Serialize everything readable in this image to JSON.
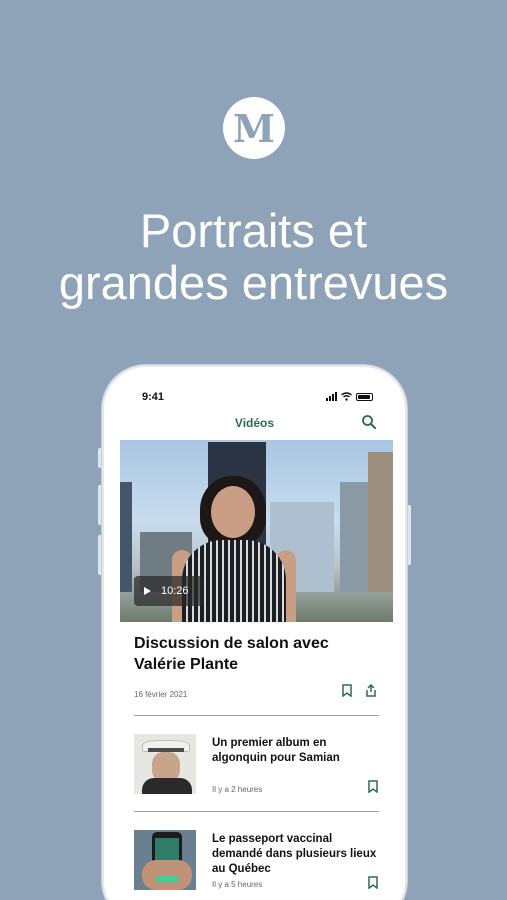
{
  "brand": {
    "logo_letter": "M"
  },
  "headline": {
    "line1": "Portraits et",
    "line2": "grandes entrevues"
  },
  "phone": {
    "status_time": "9:41",
    "nav_title": "Vidéos",
    "featured": {
      "duration": "10:26",
      "title": "Discussion de salon avec Valérie Plante",
      "date": "16 février 2021"
    },
    "articles": [
      {
        "title": "Un premier album en algonquin pour Samian",
        "time": "Il y a 2 heures"
      },
      {
        "title": "Le passeport vaccinal demandé dans plusieurs lieux au Québec",
        "time": "Il y a 5 heures"
      }
    ]
  },
  "colors": {
    "background": "#8fa3b8",
    "accent": "#2d6a58",
    "text": "#111111"
  }
}
